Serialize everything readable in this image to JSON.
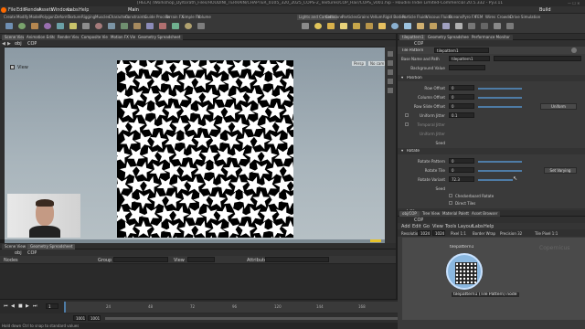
{
  "window": {
    "title": "[HELA] /Workshop_Dyltorath_Files/HOUDINI_TERRAIN/CHAPTER_0105_320_2025_COPS-2_Textures/COP_Hair/COPS_v001.hip - Houdini Indie Limited-Commercial 20.5.332 - Py3.11"
  },
  "menu": [
    "File",
    "Edit",
    "Render",
    "Assets",
    "Windows",
    "Labs",
    "Help"
  ],
  "menu_right": {
    "main_label": "Main",
    "build_label": "Build"
  },
  "shelf": {
    "tabs": [
      "Create",
      "Modify",
      "Model",
      "Polygon",
      "Deform",
      "Texture",
      "Rigging",
      "Muscles",
      "Characters",
      "Constraints",
      "Guide Process",
      "Terrain FX",
      "Simple FX",
      "Volume"
    ],
    "right_tabs": [
      "Lights and Cameras",
      "Collisions",
      "Particles",
      "Grains",
      "Vellum",
      "Rigid Bodies",
      "Particle Fluids",
      "Viscous Fluids",
      "Oceans",
      "Pyro FX",
      "FEM",
      "Wires",
      "Crowds",
      "Drive Simulation"
    ]
  },
  "left_panel": {
    "tabs": [
      "Scene View",
      "Animation Editor",
      "Render View",
      "Composite View",
      "Motion FX View",
      "Geometry Spreadsheet"
    ],
    "path": "obj",
    "cop": "COP",
    "view_label": "View",
    "persp_label": "Persp",
    "cam_label": "No cam"
  },
  "viewer": {
    "pattern_rows": 12,
    "pattern_cols": 12
  },
  "right_panel": {
    "tabs": [
      "tilepattern1",
      "Geometry Spreadsheet",
      "Performance Monitor"
    ],
    "path": "COP",
    "node_type": "Tile Pattern",
    "node_name": "tilepattern1",
    "info": "1 node selected",
    "fields": {
      "Base Name and Path": "tilepattern1",
      "Background Value": "",
      "Row Offset": "0",
      "Column Offset": "0",
      "Row Slide Offset": "0",
      "Uniform Jitter": "0.1",
      "Rotate Pattern": "0",
      "Rotate Tile": "0",
      "Rotate Variant": "72.3"
    },
    "sections": {
      "position": "Position",
      "rotate": "Rotate",
      "size": "Size"
    },
    "labels": [
      "Background Value",
      "Row Offset",
      "Column Offset",
      "Row Slide Offset",
      "Uniform Jitter",
      "Temporal Jitter",
      "Uniform Jitter",
      "Seed",
      "Rotate Pattern",
      "Rotate Tile",
      "Rotate Variant",
      "Seed"
    ],
    "uniform_button": "Uniform",
    "set_varying_button": "Set Varying",
    "checkboxes": [
      "Checkerboard Rotate",
      "Direct Tiles"
    ]
  },
  "network": {
    "tabs": [
      "obj/COP",
      "Tree View",
      "Material Palette",
      "Asset Browser"
    ],
    "menu": [
      "Add",
      "Edit",
      "Go",
      "View",
      "Tools",
      "Layout",
      "Labs",
      "Help"
    ],
    "path": "COP",
    "toolbar": {
      "resolution_label": "Resolution",
      "resolution_x": "1024",
      "resolution_y": "1024",
      "pixel_size": "Pixel 1:1",
      "border": "Border Wrap",
      "precision": "Precision 32",
      "view": "Tile Pixel 1:1"
    },
    "node_label": "tilepattern1",
    "status": "tilepattern1 (Tile Pattern) node",
    "watermark": "Copernicus"
  },
  "timeline": {
    "start": "1",
    "end": "240",
    "current": "1",
    "marks": [
      "24",
      "48",
      "72",
      "96",
      "120",
      "144",
      "168",
      "192",
      "216",
      "240"
    ],
    "frame_start": "1001",
    "frame_end": "1001",
    "range_end": "1240",
    "range_end2": "1240",
    "auto_update": "Auto Update",
    "status_left": "Hold down Ctrl to snap to standard values",
    "keys": "0 keys, 0/0 channels",
    "key_all": "Key All Channels"
  },
  "bottom_pane": {
    "tabs": [
      "Scene View",
      "Geometry Spreadsheet"
    ],
    "path": "obj",
    "cop": "COP",
    "nodes_label": "Nodes",
    "group_label": "Group",
    "view_label": "View",
    "attributes_label": "Attributes"
  },
  "colors": {
    "accent": "#4e7ca6",
    "slider": "#5a8fc2",
    "network_bg": "#4a4a4a"
  }
}
